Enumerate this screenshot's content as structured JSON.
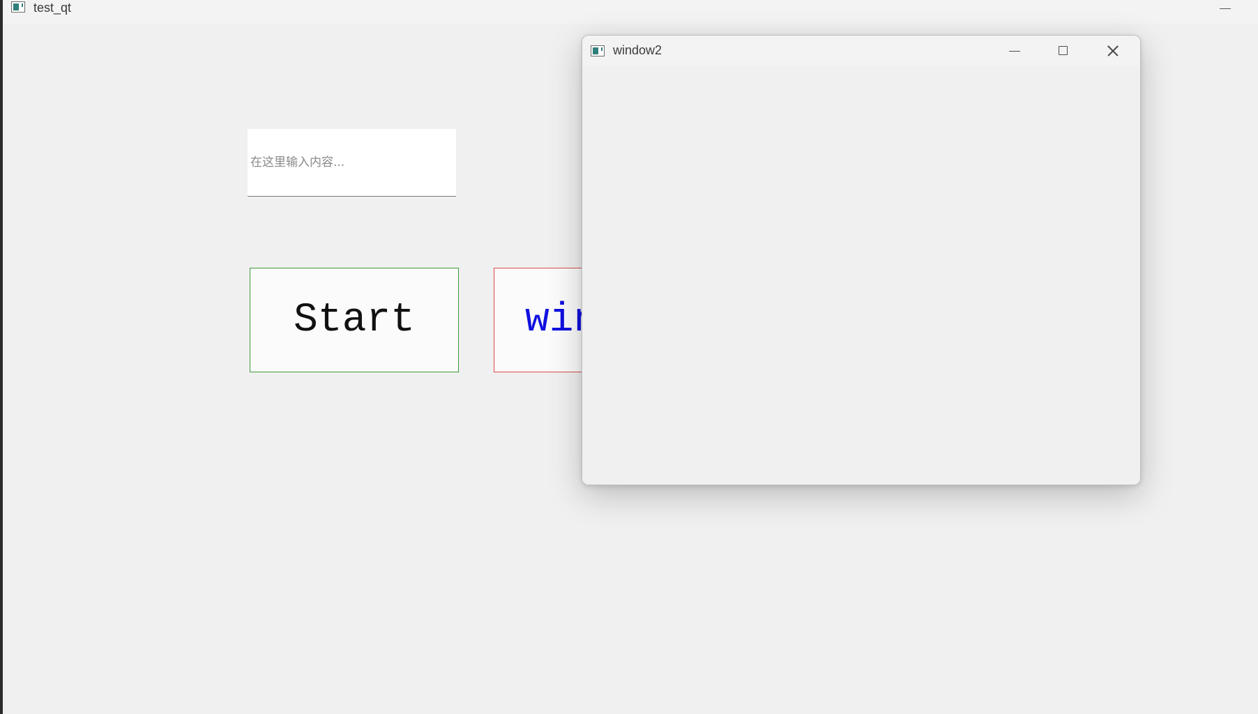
{
  "main_window": {
    "title": "test_qt",
    "icon": "app-icon",
    "controls": {
      "minimize_icon": "minimize-icon"
    }
  },
  "input": {
    "placeholder": "在这里输入内容...",
    "value": ""
  },
  "buttons": {
    "start_label": "Start",
    "window_label": "window2"
  },
  "colors": {
    "start_border": "#3c9a3c",
    "start_text": "#111111",
    "window_border": "#d84a4a",
    "window_text": "#1010e0"
  },
  "child_window": {
    "title": "window2",
    "icon": "app-icon",
    "controls": {
      "minimize_icon": "minimize-icon",
      "maximize_icon": "maximize-icon",
      "close_icon": "close-icon"
    }
  }
}
